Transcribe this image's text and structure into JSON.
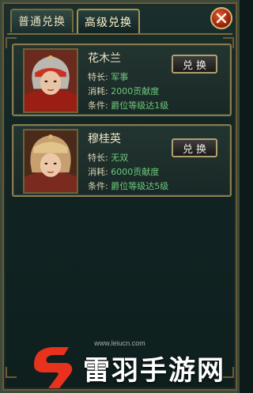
{
  "tabs": [
    {
      "label": "普通兑换",
      "active": false
    },
    {
      "label": "高级兑换",
      "active": true
    }
  ],
  "close_icon": "close-icon",
  "items": [
    {
      "name": "花木兰",
      "specialty_label": "特长:",
      "specialty_value": "军事",
      "cost_label": "消耗:",
      "cost_value": "2000贡献度",
      "condition_label": "条件:",
      "condition_value": "爵位等级达1级",
      "button_label": "兑换"
    },
    {
      "name": "穆桂英",
      "specialty_label": "特长:",
      "specialty_value": "无双",
      "cost_label": "消耗:",
      "cost_value": "6000贡献度",
      "condition_label": "条件:",
      "condition_value": "爵位等级达5级",
      "button_label": "兑换"
    }
  ],
  "watermark": {
    "url": "www.leiucn.com",
    "text": "雷羽手游网"
  },
  "colors": {
    "accent_gold": "#8a7a4a",
    "value_green": "#6ec87a",
    "close_red": "#c23a1e"
  }
}
